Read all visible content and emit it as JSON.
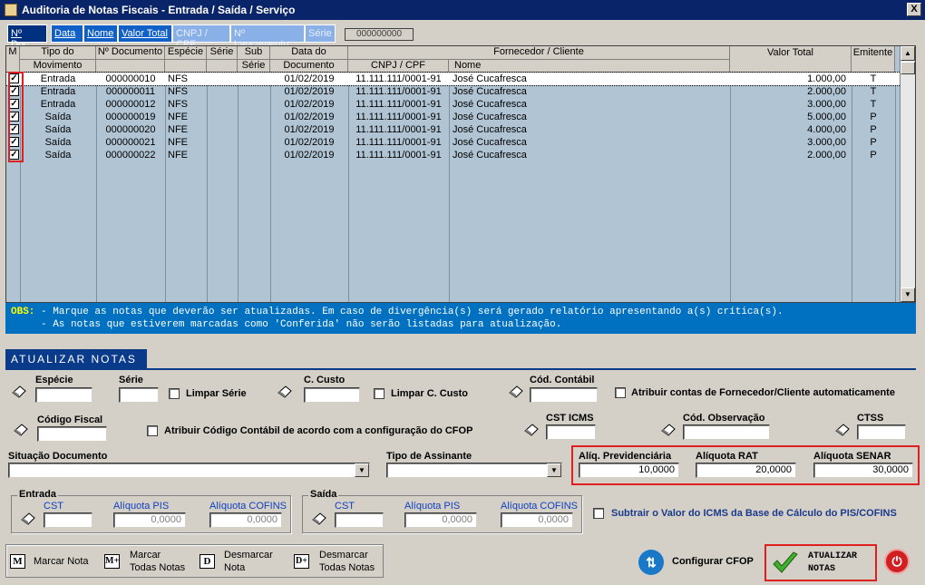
{
  "window": {
    "title": "Auditoria de Notas Fiscais   -  Entrada / Saída / Serviço",
    "close": "X"
  },
  "tabs": [
    {
      "label": "Nº Doc."
    },
    {
      "label": "Data"
    },
    {
      "label": "Nome"
    },
    {
      "label": "Valor Total"
    },
    {
      "label": "CNPJ / CPF"
    },
    {
      "label": "Nº Lançamento"
    },
    {
      "label": "Série"
    }
  ],
  "search": {
    "value": "000000000"
  },
  "grid": {
    "headers": {
      "m": "M",
      "tipo1": "Tipo do",
      "tipo2": "Movimento",
      "num": "Nº Documento",
      "especie": "Espécie",
      "serie": "Série",
      "sub1": "Sub",
      "sub2": "Série",
      "data1": "Data do",
      "data2": "Documento",
      "forn": "Fornecedor / Cliente",
      "cnpj": "CNPJ / CPF",
      "nome": "Nome",
      "valor": "Valor Total",
      "emit": "Emitente"
    },
    "rows": [
      {
        "checked": "✓",
        "tipo": "Entrada",
        "num": "000000010",
        "especie": "NFS",
        "serie": "",
        "sub": "",
        "data": "01/02/2019",
        "cnpj": "11.111.111/0001-91",
        "nome": "José Cucafresca",
        "valor": "1.000,00",
        "emit": "T"
      },
      {
        "checked": "✓",
        "tipo": "Entrada",
        "num": "000000011",
        "especie": "NFS",
        "serie": "",
        "sub": "",
        "data": "01/02/2019",
        "cnpj": "11.111.111/0001-91",
        "nome": "José Cucafresca",
        "valor": "2.000,00",
        "emit": "T"
      },
      {
        "checked": "✓",
        "tipo": "Entrada",
        "num": "000000012",
        "especie": "NFS",
        "serie": "",
        "sub": "",
        "data": "01/02/2019",
        "cnpj": "11.111.111/0001-91",
        "nome": "José Cucafresca",
        "valor": "3.000,00",
        "emit": "T"
      },
      {
        "checked": "✓",
        "tipo": "Saída",
        "num": "000000019",
        "especie": "NFE",
        "serie": "",
        "sub": "",
        "data": "01/02/2019",
        "cnpj": "11.111.111/0001-91",
        "nome": "José Cucafresca",
        "valor": "5.000,00",
        "emit": "P"
      },
      {
        "checked": "✓",
        "tipo": "Saída",
        "num": "000000020",
        "especie": "NFE",
        "serie": "",
        "sub": "",
        "data": "01/02/2019",
        "cnpj": "11.111.111/0001-91",
        "nome": "José Cucafresca",
        "valor": "4.000,00",
        "emit": "P"
      },
      {
        "checked": "✓",
        "tipo": "Saída",
        "num": "000000021",
        "especie": "NFE",
        "serie": "",
        "sub": "",
        "data": "01/02/2019",
        "cnpj": "11.111.111/0001-91",
        "nome": "José Cucafresca",
        "valor": "3.000,00",
        "emit": "P"
      },
      {
        "checked": "✓",
        "tipo": "Saída",
        "num": "000000022",
        "especie": "NFE",
        "serie": "",
        "sub": "",
        "data": "01/02/2019",
        "cnpj": "11.111.111/0001-91",
        "nome": "José Cucafresca",
        "valor": "2.000,00",
        "emit": "P"
      }
    ]
  },
  "obs": {
    "label": "OBS:",
    "line1": " - Marque as notas que deverão ser atualizadas. Em caso de divergência(s) será gerado relatório apresentando a(s) crítica(s).",
    "line2": "     - As notas que estiverem marcadas como 'Conferida' não serão listadas para atualização."
  },
  "section": {
    "title": "ATUALIZAR NOTAS"
  },
  "form": {
    "especie": {
      "label": "Espécie",
      "value": ""
    },
    "serie": {
      "label": "Série",
      "value": ""
    },
    "limpar_serie": "Limpar Série",
    "c_custo": {
      "label": "C. Custo",
      "value": ""
    },
    "limpar_custo": "Limpar C. Custo",
    "cod_contabil": {
      "label": "Cód. Contábil",
      "value": ""
    },
    "atribuir_contas": "Atribuir contas de Fornecedor/Cliente automaticamente",
    "cod_fiscal": {
      "label": "Código Fiscal",
      "value": ""
    },
    "atribuir_cfop": "Atribuir Código Contábil de acordo com a configuração do CFOP",
    "cst_icms": {
      "label": "CST ICMS",
      "value": ""
    },
    "cod_obs": {
      "label": "Cód. Observação",
      "value": ""
    },
    "ctss": {
      "label": "CTSS",
      "value": ""
    },
    "situacao": {
      "label": "Situação Documento",
      "value": ""
    },
    "assinante": {
      "label": "Tipo de Assinante",
      "value": ""
    },
    "aliq_prev": {
      "label": "Alíq. Previdenciária",
      "value": "10,0000"
    },
    "aliq_rat": {
      "label": "Alíquota RAT",
      "value": "20,0000"
    },
    "aliq_senar": {
      "label": "Alíquota SENAR",
      "value": "30,0000"
    },
    "entrada": {
      "title": "Entrada",
      "cst": "CST",
      "pis": "Alíquota PIS",
      "pis_value": "0,0000",
      "cofins": "Alíquota COFINS",
      "cofins_value": "0,0000"
    },
    "saida": {
      "title": "Saída",
      "cst": "CST",
      "pis": "Alíquota PIS",
      "pis_value": "0,0000",
      "cofins": "Alíquota COFINS",
      "cofins_value": "0,0000"
    },
    "subtrair": "Subtrair o Valor do ICMS da Base de Cálculo  do PIS/COFINS"
  },
  "actions": {
    "marcar_key": "M",
    "marcar": "Marcar Nota",
    "marcar_todas_key": "M+",
    "marcar_todas_1": "Marcar",
    "marcar_todas_2": "Todas Notas",
    "desmarcar_key": "D",
    "desmarcar_1": "Desmarcar",
    "desmarcar_2": "Nota",
    "desmarcar_todas_key": "D+",
    "desmarcar_todas_1": "Desmarcar",
    "desmarcar_todas_2": "Todas Notas",
    "cfop": "Configurar CFOP",
    "atualizar_1": "ATUALIZAR",
    "atualizar_2": "NOTAS"
  },
  "colors": {
    "title": "#0a246a",
    "grid_bg": "#b0c4d4",
    "obs_bg": "#0070c0",
    "highlight": "#e02020",
    "tab": "#1060c8"
  }
}
